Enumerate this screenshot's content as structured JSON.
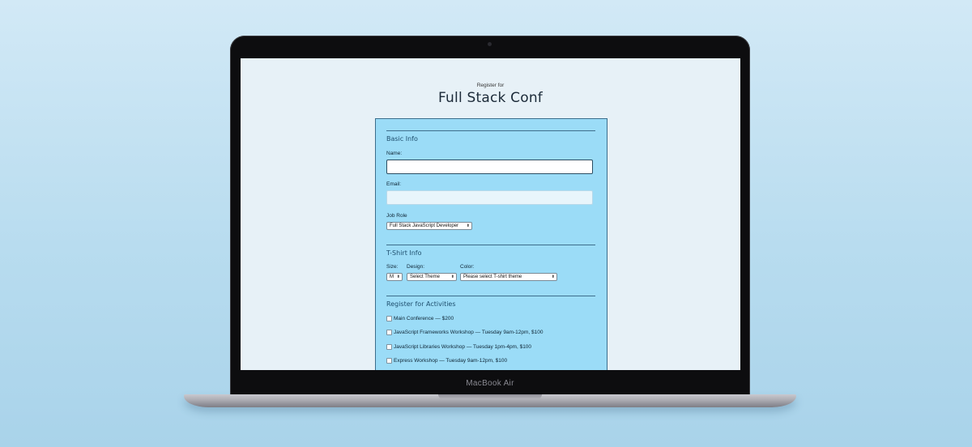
{
  "page": {
    "subtitle": "Register for",
    "title": "Full Stack Conf"
  },
  "device": {
    "brand": "MacBook Air"
  },
  "basic_info": {
    "legend": "Basic Info",
    "name_label": "Name:",
    "name_value": "",
    "email_label": "Email:",
    "email_value": "",
    "job_role_label": "Job Role",
    "job_role_selected": "Full Stack JavaScript Developer"
  },
  "tshirt_info": {
    "legend": "T-Shirt Info",
    "size_label": "Size:",
    "size_selected": "M",
    "design_label": "Design:",
    "design_selected": "Select Theme",
    "color_label": "Color:",
    "color_selected": "Please select T-shirt theme"
  },
  "activities": {
    "legend": "Register for Activities",
    "items": [
      {
        "label": "Main Conference — $200",
        "checked": false
      },
      {
        "label": "JavaScript Frameworks Workshop — Tuesday 9am-12pm, $100",
        "checked": false
      },
      {
        "label": "JavaScript Libraries Workshop — Tuesday 1pm-4pm, $100",
        "checked": false
      },
      {
        "label": "Express Workshop — Tuesday 9am-12pm, $100",
        "checked": false
      }
    ]
  },
  "colors": {
    "form_bg": "#9bdcf7",
    "screen_bg": "#e7f1f7",
    "backdrop": "#c6e4f4"
  }
}
